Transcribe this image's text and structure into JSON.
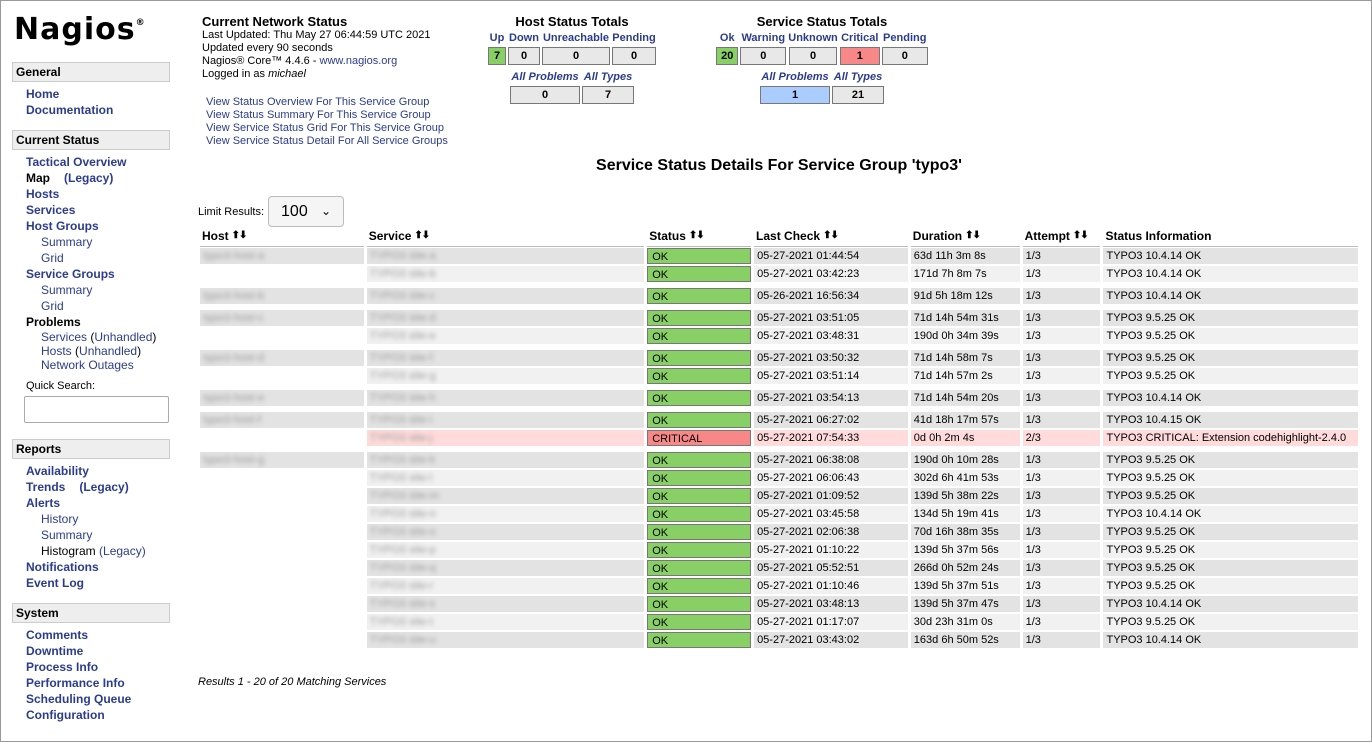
{
  "logo": {
    "text": "Nagios",
    "mark": "®"
  },
  "sidebar": {
    "general": {
      "title": "General",
      "items": [
        "Home",
        "Documentation"
      ]
    },
    "current": {
      "title": "Current Status",
      "tactical": "Tactical Overview",
      "map": "Map",
      "map_legacy": "(Legacy)",
      "hosts": "Hosts",
      "services": "Services",
      "host_groups": "Host Groups",
      "hg_summary": "Summary",
      "hg_grid": "Grid",
      "service_groups": "Service Groups",
      "sg_summary": "Summary",
      "sg_grid": "Grid",
      "problems": "Problems",
      "p_services": "Services",
      "p_hosts": "Hosts",
      "p_unhandled": "Unhandled",
      "p_outages": "Network Outages",
      "quick_search": "Quick Search:"
    },
    "reports": {
      "title": "Reports",
      "availability": "Availability",
      "trends": "Trends",
      "trends_legacy": "(Legacy)",
      "alerts": "Alerts",
      "history": "History",
      "summary": "Summary",
      "histogram": "Histogram",
      "histogram_legacy": "(Legacy)",
      "notifications": "Notifications",
      "event_log": "Event Log"
    },
    "system": {
      "title": "System",
      "items": [
        "Comments",
        "Downtime",
        "Process Info",
        "Performance Info",
        "Scheduling Queue",
        "Configuration"
      ]
    }
  },
  "status": {
    "title": "Current Network Status",
    "last_updated": "Last Updated: Thu May 27 06:44:59 UTC 2021",
    "interval": "Updated every 90 seconds",
    "version": "Nagios® Core™ 4.4.6 - ",
    "site": "www.nagios.org",
    "logged_prefix": "Logged in as ",
    "user": "michael"
  },
  "links": [
    "View Status Overview For This Service Group",
    "View Status Summary For This Service Group",
    "View Service Status Grid For This Service Group",
    "View Service Status Detail For All Service Groups"
  ],
  "host_totals": {
    "title": "Host Status Totals",
    "labels": [
      "Up",
      "Down",
      "Unreachable",
      "Pending"
    ],
    "values": [
      "7",
      "0",
      "0",
      "0"
    ],
    "all_labels": [
      "All Problems",
      "All Types"
    ],
    "all_values": [
      "0",
      "7"
    ]
  },
  "service_totals": {
    "title": "Service Status Totals",
    "labels": [
      "Ok",
      "Warning",
      "Unknown",
      "Critical",
      "Pending"
    ],
    "values": [
      "20",
      "0",
      "0",
      "1",
      "0"
    ],
    "all_labels": [
      "All Problems",
      "All Types"
    ],
    "all_values": [
      "1",
      "21"
    ]
  },
  "colors": {
    "ok": "#88d066",
    "critical": "#f88888",
    "link": "#2b3c8f",
    "problems_highlight": "#aaccff"
  },
  "page_title": "Service Status Details For Service Group 'typo3'",
  "limit": {
    "label": "Limit Results:",
    "value": "100"
  },
  "columns": [
    "Host",
    "Service",
    "Status",
    "Last Check",
    "Duration",
    "Attempt",
    "Status Information"
  ],
  "rows": [
    {
      "host": "typo3-host-a",
      "service": "TYPO3 site-a",
      "status": "OK",
      "last": "05-27-2021 01:44:54",
      "dur": "63d 11h 3m 8s",
      "att": "1/3",
      "info": "TYPO3 10.4.14 OK"
    },
    {
      "host": "",
      "service": "TYPO3 site-b",
      "status": "OK",
      "last": "05-27-2021 03:42:23",
      "dur": "171d 7h 8m 7s",
      "att": "1/3",
      "info": "TYPO3 10.4.14 OK"
    },
    {
      "host": "typo3-host-b",
      "service": "TYPO3 site-c",
      "status": "OK",
      "last": "05-26-2021 16:56:34",
      "dur": "91d 5h 18m 12s",
      "att": "1/3",
      "info": "TYPO3 10.4.14 OK"
    },
    {
      "host": "typo3-host-c",
      "service": "TYPO3 site-d",
      "status": "OK",
      "last": "05-27-2021 03:51:05",
      "dur": "71d 14h 54m 31s",
      "att": "1/3",
      "info": "TYPO3 9.5.25 OK"
    },
    {
      "host": "",
      "service": "TYPO3 site-e",
      "status": "OK",
      "last": "05-27-2021 03:48:31",
      "dur": "190d 0h 34m 39s",
      "att": "1/3",
      "info": "TYPO3 9.5.25 OK"
    },
    {
      "host": "typo3-host-d",
      "service": "TYPO3 site-f",
      "status": "OK",
      "last": "05-27-2021 03:50:32",
      "dur": "71d 14h 58m 7s",
      "att": "1/3",
      "info": "TYPO3 9.5.25 OK"
    },
    {
      "host": "",
      "service": "TYPO3 site-g",
      "status": "OK",
      "last": "05-27-2021 03:51:14",
      "dur": "71d 14h 57m 2s",
      "att": "1/3",
      "info": "TYPO3 9.5.25 OK"
    },
    {
      "host": "typo3-host-e",
      "service": "TYPO3 site-h",
      "status": "OK",
      "last": "05-27-2021 03:54:13",
      "dur": "71d 14h 54m 20s",
      "att": "1/3",
      "info": "TYPO3 10.4.14 OK"
    },
    {
      "host": "typo3-host-f",
      "service": "TYPO3 site-i",
      "status": "OK",
      "last": "05-27-2021 06:27:02",
      "dur": "41d 18h 17m 57s",
      "att": "1/3",
      "info": "TYPO3 10.4.15 OK"
    },
    {
      "host": "",
      "service": "TYPO3 site-j",
      "status": "CRITICAL",
      "last": "05-27-2021 07:54:33",
      "dur": "0d 0h 2m 4s",
      "att": "2/3",
      "info": "TYPO3 CRITICAL: Extension codehighlight-2.4.0"
    },
    {
      "host": "typo3-host-g",
      "service": "TYPO3 site-k",
      "status": "OK",
      "last": "05-27-2021 06:38:08",
      "dur": "190d 0h 10m 28s",
      "att": "1/3",
      "info": "TYPO3 9.5.25 OK"
    },
    {
      "host": "",
      "service": "TYPO3 site-l",
      "status": "OK",
      "last": "05-27-2021 06:06:43",
      "dur": "302d 6h 41m 53s",
      "att": "1/3",
      "info": "TYPO3 9.5.25 OK"
    },
    {
      "host": "",
      "service": "TYPO3 site-m",
      "status": "OK",
      "last": "05-27-2021 01:09:52",
      "dur": "139d 5h 38m 22s",
      "att": "1/3",
      "info": "TYPO3 9.5.25 OK"
    },
    {
      "host": "",
      "service": "TYPO3 site-n",
      "status": "OK",
      "last": "05-27-2021 03:45:58",
      "dur": "134d 5h 19m 41s",
      "att": "1/3",
      "info": "TYPO3 10.4.14 OK"
    },
    {
      "host": "",
      "service": "TYPO3 site-o",
      "status": "OK",
      "last": "05-27-2021 02:06:38",
      "dur": "70d 16h 38m 35s",
      "att": "1/3",
      "info": "TYPO3 9.5.25 OK"
    },
    {
      "host": "",
      "service": "TYPO3 site-p",
      "status": "OK",
      "last": "05-27-2021 01:10:22",
      "dur": "139d 5h 37m 56s",
      "att": "1/3",
      "info": "TYPO3 9.5.25 OK"
    },
    {
      "host": "",
      "service": "TYPO3 site-q",
      "status": "OK",
      "last": "05-27-2021 05:52:51",
      "dur": "266d 0h 52m 24s",
      "att": "1/3",
      "info": "TYPO3 9.5.25 OK"
    },
    {
      "host": "",
      "service": "TYPO3 site-r",
      "status": "OK",
      "last": "05-27-2021 01:10:46",
      "dur": "139d 5h 37m 51s",
      "att": "1/3",
      "info": "TYPO3 9.5.25 OK"
    },
    {
      "host": "",
      "service": "TYPO3 site-s",
      "status": "OK",
      "last": "05-27-2021 03:48:13",
      "dur": "139d 5h 37m 47s",
      "att": "1/3",
      "info": "TYPO3 10.4.14 OK"
    },
    {
      "host": "",
      "service": "TYPO3 site-t",
      "status": "OK",
      "last": "05-27-2021 01:17:07",
      "dur": "30d 23h 31m 0s",
      "att": "1/3",
      "info": "TYPO3 9.5.25 OK"
    },
    {
      "host": "",
      "service": "TYPO3 site-u",
      "status": "OK",
      "last": "05-27-2021 03:43:02",
      "dur": "163d 6h 50m 52s",
      "att": "1/3",
      "info": "TYPO3 10.4.14 OK"
    }
  ],
  "results": "Results 1 - 20 of 20 Matching Services"
}
